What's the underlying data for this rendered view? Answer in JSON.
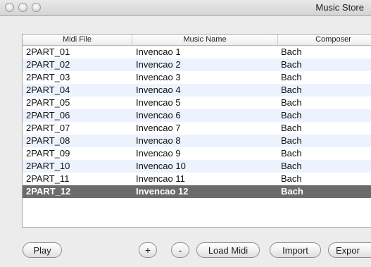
{
  "window": {
    "title": "Music Store"
  },
  "table": {
    "columns": [
      "Midi File",
      "Music Name",
      "Composer"
    ],
    "rows": [
      [
        "2PART_01",
        "Invencao 1",
        "Bach"
      ],
      [
        "2PART_02",
        "Invencao 2",
        "Bach"
      ],
      [
        "2PART_03",
        "Invencao 3",
        "Bach"
      ],
      [
        "2PART_04",
        "Invencao 4",
        "Bach"
      ],
      [
        "2PART_05",
        "Invencao 5",
        "Bach"
      ],
      [
        "2PART_06",
        "Invencao 6",
        "Bach"
      ],
      [
        "2PART_07",
        "Invencao 7",
        "Bach"
      ],
      [
        "2PART_08",
        "Invencao 8",
        "Bach"
      ],
      [
        "2PART_09",
        "Invencao 9",
        "Bach"
      ],
      [
        "2PART_10",
        "Invencao 10",
        "Bach"
      ],
      [
        "2PART_11",
        "Invencao 11",
        "Bach"
      ],
      [
        "2PART_12",
        "Invencao 12",
        "Bach"
      ]
    ],
    "selected_row": "2PART_12"
  },
  "buttons": {
    "play": "Play",
    "add": "+",
    "remove": "-",
    "load_midi": "Load Midi",
    "import": "Import",
    "export": "Expor"
  }
}
